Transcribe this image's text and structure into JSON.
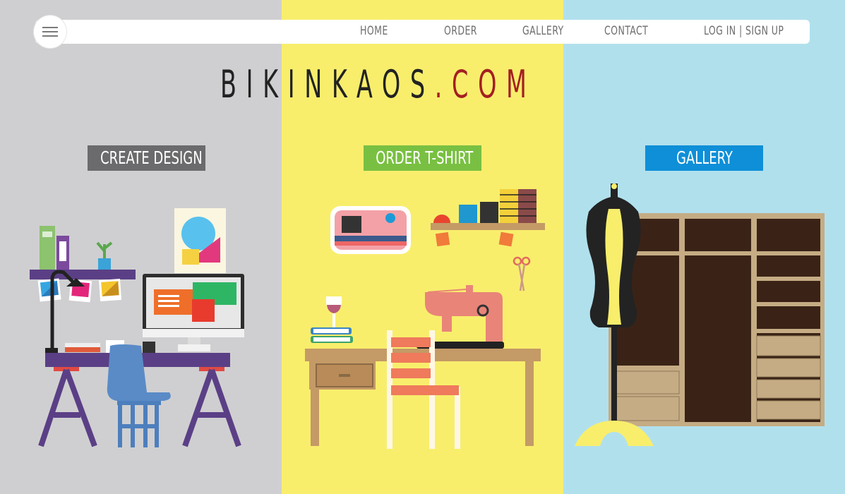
{
  "nav": {
    "menu_icon": "hamburger-menu-icon",
    "links": [
      "HOME",
      "ORDER",
      "GALLERY",
      "CONTACT",
      "LOG IN | SIGN UP"
    ]
  },
  "brand": {
    "name": "BIKINKAOS",
    "dot": ".",
    "tld": "COM"
  },
  "sections": [
    {
      "label": "CREATE DESIGN",
      "color": "#6b6b6d"
    },
    {
      "label": "ORDER T-SHIRT",
      "color": "#79c042"
    },
    {
      "label": "GALLERY",
      "color": "#0e8fd8"
    }
  ],
  "colors": {
    "panel_left": "#cfcfd1",
    "panel_middle": "#f8ee6c",
    "panel_right": "#b1e0ed",
    "accent": "#a41e22"
  }
}
